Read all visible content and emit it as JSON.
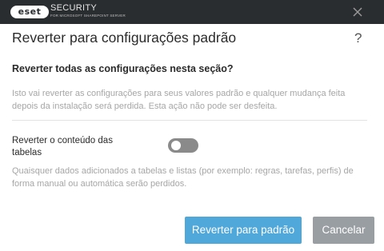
{
  "window": {
    "logo": "eset",
    "product": "SECURITY",
    "product_sub": "FOR MICROSOFT SHAREPOINT SERVER",
    "close_icon": "close-icon"
  },
  "dialog": {
    "title": "Reverter para configurações padrão",
    "help": "?",
    "question": "Reverter todas as configurações nesta seção?",
    "description": "Isto vai reverter as configurações para seus valores padrão e qualquer mudança feita depois da instalação será perdida. Esta ação não pode ser desfeita.",
    "toggle": {
      "label": "Reverter o conteúdo das tabelas",
      "on": false
    },
    "note": "Quaisquer dados adicionados a tabelas e listas (por exemplo: regras, tarefas, perfis) de forma manual ou automática serão perdidos.",
    "buttons": {
      "confirm": "Reverter para padrão",
      "cancel": "Cancelar"
    }
  },
  "colors": {
    "titlebar": "#2a2d30",
    "primary": "#4fa7da",
    "secondary": "#999ea2",
    "toggle_off": "#8a8a8a"
  }
}
